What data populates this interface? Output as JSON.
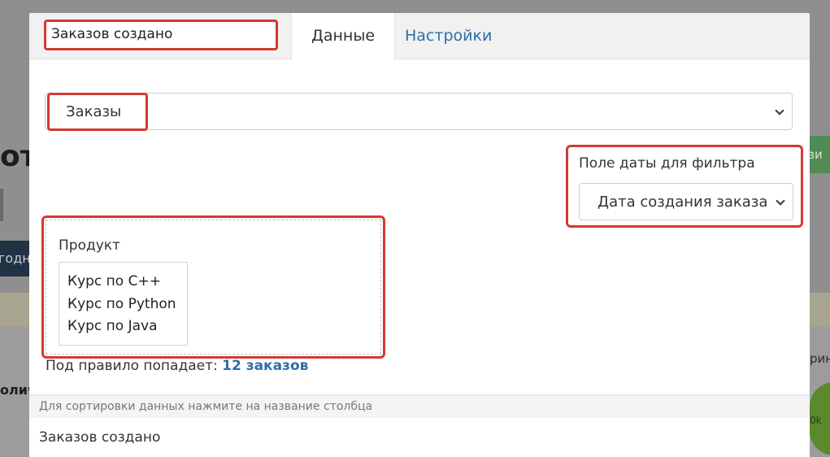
{
  "background": {
    "heading": "от",
    "navy_text": "годн",
    "column_text": "олич",
    "green_button": "зи",
    "right_text": "рин",
    "right_small": "0k"
  },
  "modal": {
    "title_input_value": "Заказов создано",
    "tabs": [
      {
        "label": "Данные",
        "active": true
      },
      {
        "label": "Настройки",
        "active": false
      }
    ],
    "source_select": {
      "value": "Заказы"
    },
    "date_filter": {
      "label": "Поле даты для фильтра",
      "value": "Дата создания заказа"
    },
    "product_filter": {
      "label": "Продукт",
      "items": [
        "Курс по C++",
        "Курс по Python",
        "Курс по Java"
      ]
    },
    "rule_count": {
      "prefix": "Под правило попадает:",
      "value": "12 заказов"
    },
    "sort_hint": "Для сортировки данных нажмите на название столбца",
    "table_title": "Заказов создано"
  },
  "colors": {
    "highlight": "#d23a33",
    "link": "#2f6ea5"
  }
}
